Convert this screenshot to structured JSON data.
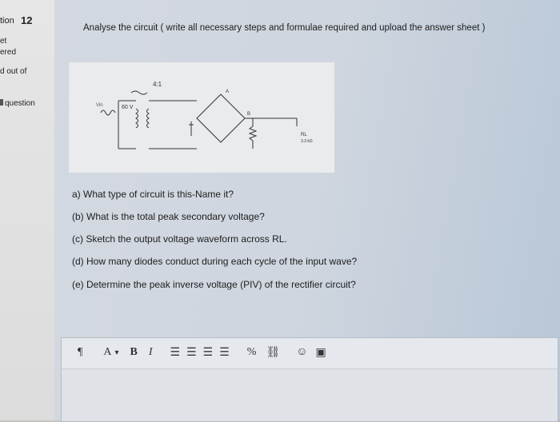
{
  "sidebar": {
    "question_label": "tion",
    "question_number": "12",
    "status_line1": "et",
    "status_line2": "ered",
    "marks_label": "d out of",
    "flag_label": "question"
  },
  "question": {
    "instruction": "Analyse the circuit ( write all necessary steps and formulae required and upload the answer sheet )",
    "parts": [
      "a) What type of circuit is this-Name it?",
      "(b) What is the total peak secondary voltage?",
      "(c) Sketch the output voltage waveform across RL.",
      "(d) How many diodes conduct during each cycle of the input wave?",
      "(e) Determine  the  peak inverse voltage (PIV) of the rectifier circuit?"
    ]
  },
  "circuit": {
    "ratio_label": "4:1",
    "source_label": "60 V",
    "vin_label": "Vin",
    "node_a": "A",
    "node_b": "B",
    "load_label": "RL",
    "load_value": "3.3 kΩ"
  },
  "editor": {
    "toolbar": {
      "paragraph": "¶",
      "font_color": "A",
      "font_color_dropdown": "▾",
      "bold": "B",
      "italic": "I",
      "unordered_list": "☰",
      "ordered_list": "☰",
      "indent": "☰",
      "outdent": "☰",
      "link": "%",
      "unlink": "⛓",
      "emoji": "☺",
      "image": "▣"
    },
    "content": ""
  }
}
